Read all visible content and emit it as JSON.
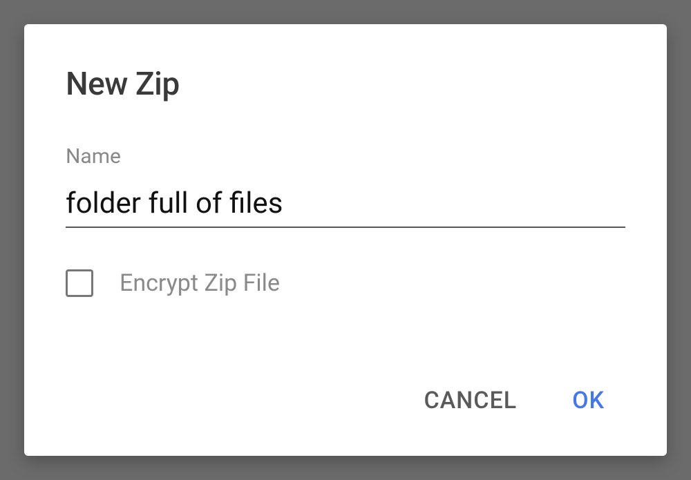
{
  "dialog": {
    "title": "New Zip",
    "nameField": {
      "label": "Name",
      "value": "folder full of files"
    },
    "encrypt": {
      "label": "Encrypt Zip File",
      "checked": false
    },
    "buttons": {
      "cancel": "CANCEL",
      "ok": "OK"
    }
  }
}
